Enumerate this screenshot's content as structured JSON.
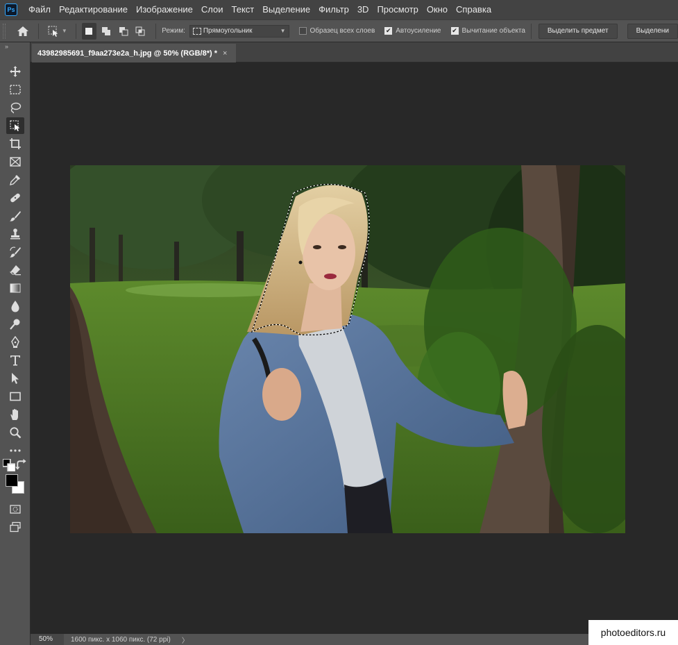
{
  "app": {
    "logo": "Ps"
  },
  "menu": [
    "Файл",
    "Редактирование",
    "Изображение",
    "Слои",
    "Текст",
    "Выделение",
    "Фильтр",
    "3D",
    "Просмотр",
    "Окно",
    "Справка"
  ],
  "options": {
    "mode_label": "Режим:",
    "mode_value": "Прямоугольник",
    "sample_all_layers": {
      "label": "Образец всех слоев",
      "checked": false
    },
    "auto_enhance": {
      "label": "Автоусиление",
      "checked": true
    },
    "object_subtract": {
      "label": "Вычитание объекта",
      "checked": true
    },
    "select_subject_label": "Выделить предмет",
    "select_and_mask_label": "Выделени"
  },
  "tools": [
    "move-icon",
    "marquee-icon",
    "lasso-icon",
    "object-selection-icon",
    "crop-icon",
    "frame-icon",
    "eyedropper-icon",
    "healing-brush-icon",
    "brush-icon",
    "clone-stamp-icon",
    "history-brush-icon",
    "eraser-icon",
    "gradient-icon",
    "blur-icon",
    "dodge-icon",
    "pen-icon",
    "type-icon",
    "path-selection-icon",
    "rectangle-icon",
    "hand-icon",
    "zoom-icon",
    "more-tools-icon"
  ],
  "document": {
    "tab_title": "43982985691_f9aa273e2a_h.jpg @ 50% (RGB/8*) *",
    "close": "×"
  },
  "status": {
    "zoom": "50%",
    "info": "1600 пикс. x 1060 пикс. (72 ppi)",
    "arrow": "〉"
  },
  "watermark": "photoeditors.ru",
  "colors": {
    "foreground": "#000000",
    "background": "#ffffff",
    "accent": "#31a8ff"
  }
}
